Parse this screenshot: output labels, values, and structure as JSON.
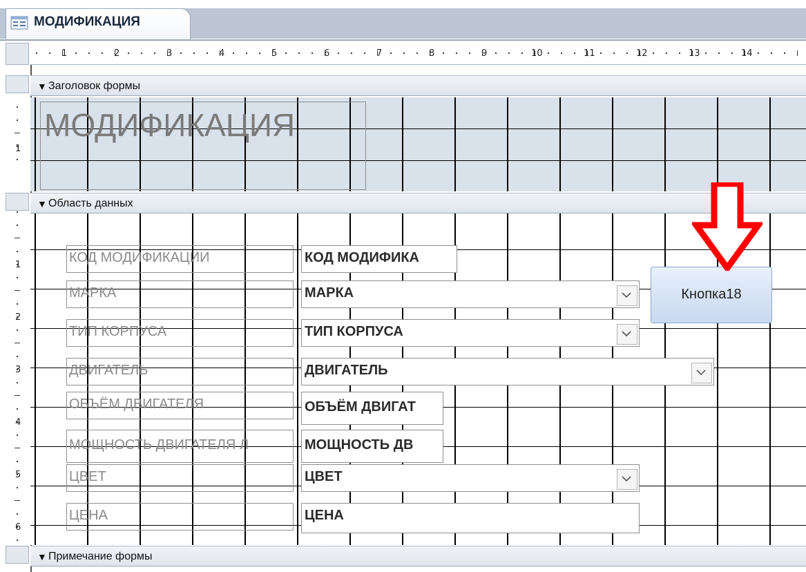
{
  "tab": {
    "title": "МОДИФИКАЦИЯ",
    "icon": "form-icon"
  },
  "ruler": {
    "horizontal_numbers": [
      "1",
      "2",
      "3",
      "4",
      "5",
      "6",
      "7",
      "8",
      "9",
      "10",
      "11",
      "12",
      "13",
      "14"
    ],
    "vertical_numbers": [
      "1",
      "1",
      "2",
      "3",
      "4",
      "5",
      "6"
    ]
  },
  "sections": {
    "header": "Заголовок формы",
    "detail": "Область данных",
    "footer": "Примечание формы"
  },
  "header_title": "МОДИФИКАЦИЯ",
  "fields": [
    {
      "label": "КОД МОДИФИКАЦИИ",
      "control": "КОД МОДИФИКА",
      "type": "textbox"
    },
    {
      "label": "МАРКА",
      "control": "МАРКА",
      "type": "combobox"
    },
    {
      "label": "ТИП КОРПУСА",
      "control": "ТИП КОРПУСА",
      "type": "combobox"
    },
    {
      "label": "ДВИГАТЕЛЬ",
      "control": "ДВИГАТЕЛЬ",
      "type": "combobox"
    },
    {
      "label": "ОБЪЁМ ДВИГАТЕЛЯ",
      "control": "ОБЪЁМ ДВИГАТ",
      "type": "textbox"
    },
    {
      "label": "МОЩНОСТЬ ДВИГАТЕЛЯ Л",
      "control": "МОЩНОСТЬ ДВ",
      "type": "textbox"
    },
    {
      "label": "ЦВЕТ",
      "control": "ЦВЕТ",
      "type": "combobox"
    },
    {
      "label": "ЦЕНА",
      "control": "ЦЕНА",
      "type": "textbox"
    }
  ],
  "button": {
    "label": "Кнопка18"
  },
  "colors": {
    "grid_header_bg": "#d9e1ea",
    "arrow": "#ff0000",
    "button_top": "#e8f0fb",
    "button_bottom": "#c8d9f1"
  }
}
